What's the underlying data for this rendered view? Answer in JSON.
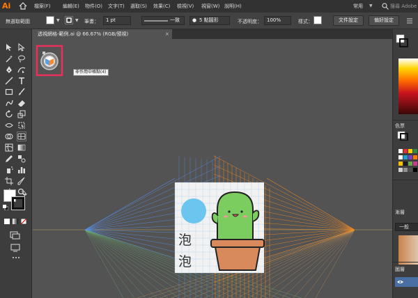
{
  "app": {
    "logo": "Ai"
  },
  "menu": [
    "檔案(F)",
    "編輯(E)",
    "物件(O)",
    "文字(T)",
    "選取(S)",
    "效果(C)",
    "檢視(V)",
    "視窗(W)",
    "說明(H)"
  ],
  "workspace": {
    "label": "常用"
  },
  "search": {
    "placeholder": "搜尋 Adobe"
  },
  "control_bar": {
    "selection": "無選取範圍",
    "stroke_label": "筆畫：",
    "stroke_value": "1 pt",
    "stroke_style": "一致",
    "brush": "5 點圓形",
    "opacity_label": "不透明度：",
    "opacity_value": "100%",
    "style_label": "樣式：",
    "doc_setup": "文件設定",
    "preferences": "偏好設定"
  },
  "document_tab": {
    "title": "透視網格-範例.ai @ 66.67% (RGB/預視)",
    "close": "×"
  },
  "tooltip": "非作用中格點(4)",
  "artwork": {
    "text_chars": [
      "泡",
      "泡"
    ]
  },
  "right_panel": {
    "color_tab": "色票",
    "stroke_tab": "漸層",
    "stroke_setting": "一般",
    "layers_tab": "圖層"
  },
  "colors": {
    "accent": "#ff7c00",
    "highlight": "#e8305a",
    "grid_blue": "#5a8ee8",
    "grid_orange": "#f08a24",
    "cactus": "#7ccd5f",
    "pot": "#d98a5c"
  }
}
